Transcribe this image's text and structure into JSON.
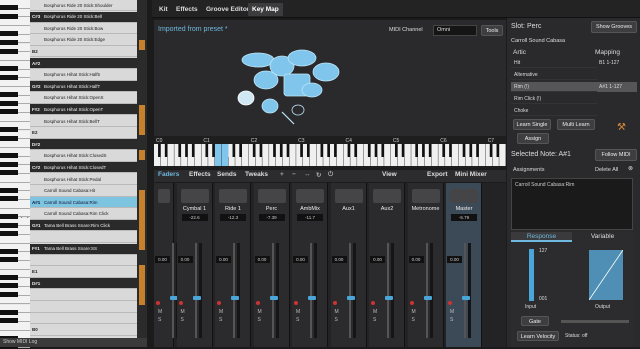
{
  "tabs": [
    "Kit",
    "Effects",
    "Groove Editor",
    "Key Map"
  ],
  "active_tab": "Key Map",
  "octave_labels": [
    "C3",
    "C2"
  ],
  "note_rows": [
    {
      "note": "",
      "label": "Bosphorus Ride 20 Stick:Shoulder",
      "style": "light"
    },
    {
      "note": "C#3",
      "label": "Bosphorus Ride 20 Stick:Bell",
      "style": "dark"
    },
    {
      "note": "",
      "label": "Bosphorus Ride 20 Stick:Bow",
      "style": "light"
    },
    {
      "note": "",
      "label": "Bosphorus Ride 20 Stick:Edge",
      "style": "light"
    },
    {
      "note": "B2",
      "label": "",
      "style": "light"
    },
    {
      "note": "A#2",
      "label": "",
      "style": "dark"
    },
    {
      "note": "",
      "label": "Bosphorus Hihat Stick:Half5",
      "style": "light"
    },
    {
      "note": "G#2",
      "label": "Bosphorus Hihat Stick:HalfT",
      "style": "dark"
    },
    {
      "note": "",
      "label": "Bosphorus Hihat Stick:OpenS",
      "style": "light"
    },
    {
      "note": "F#2",
      "label": "Bosphorus Hihat Stick:OpenT",
      "style": "dark"
    },
    {
      "note": "",
      "label": "Bosphorus Hihat Stick:BellT",
      "style": "light"
    },
    {
      "note": "E2",
      "label": "",
      "style": "light"
    },
    {
      "note": "D#2",
      "label": "",
      "style": "dark"
    },
    {
      "note": "",
      "label": "Bosphorus Hihat Stick:ClosedS",
      "style": "light"
    },
    {
      "note": "C#2",
      "label": "Bosphorus Hihat Stick:ClosedT",
      "style": "dark"
    },
    {
      "note": "",
      "label": "Bosphorus Hihat Stick:Pedal",
      "style": "light"
    },
    {
      "note": "",
      "label": "Carroll Sound Cabasa:Hit",
      "style": "light"
    },
    {
      "note": "A#1",
      "label": "Carroll Sound Cabasa:Rim",
      "style": "sel"
    },
    {
      "note": "",
      "label": "Carroll Sound Cabasa:Rim Click",
      "style": "light"
    },
    {
      "note": "G#1",
      "label": "Tama Bell Brass Snare:Rim Click",
      "style": "dark"
    },
    {
      "note": "",
      "label": "",
      "style": "light"
    },
    {
      "note": "F#1",
      "label": "Tama Bell Brass Snare:SS",
      "style": "dark"
    },
    {
      "note": "",
      "label": "",
      "style": "light"
    },
    {
      "note": "E1",
      "label": "",
      "style": "light"
    },
    {
      "note": "D#1",
      "label": "",
      "style": "dark"
    },
    {
      "note": "",
      "label": "",
      "style": "light"
    },
    {
      "note": "",
      "label": "",
      "style": "light"
    },
    {
      "note": "",
      "label": "",
      "style": "light"
    },
    {
      "note": "B0",
      "label": "",
      "style": "light"
    }
  ],
  "show_midi_log": "Show MIDI Log",
  "kit": {
    "imported": "Imported from preset *",
    "midi_channel_label": "MIDI Channel",
    "midi_channel_value": "Omni",
    "tools": "Tools"
  },
  "keyboard_octaves": [
    "C0",
    "C1",
    "C2",
    "C3",
    "C4",
    "C5",
    "C6",
    "C7",
    "C8"
  ],
  "mixer_tabs": [
    "Faders",
    "Effects",
    "Sends",
    "Tweaks"
  ],
  "mixer_right": [
    "View",
    "Export",
    "Mini Mixer"
  ],
  "strips": [
    {
      "name": "",
      "value": "",
      "level": "0.00"
    },
    {
      "name": "Cymbal 1",
      "value": "-22.6",
      "level": "0.00"
    },
    {
      "name": "Ride 1",
      "value": "-12.3",
      "level": "0.00"
    },
    {
      "name": "Perc",
      "value": "-7.39",
      "level": "0.00"
    },
    {
      "name": "AmbMix",
      "value": "-11.7",
      "level": "0.00"
    },
    {
      "name": "Aux1",
      "value": "",
      "level": "0.00"
    },
    {
      "name": "Aux2",
      "value": "",
      "level": "0.00"
    },
    {
      "name": "Metronome",
      "value": "",
      "level": "0.00"
    },
    {
      "name": "Master",
      "value": "-5.79",
      "level": "0.00"
    }
  ],
  "right": {
    "slot": "Slot: Perc",
    "show_grooves": "Show Grooves",
    "instrument": "Carroll Sound Cabasa",
    "artic_header": "Artic",
    "mapping_header": "Mapping",
    "artics": [
      "Hit",
      "Alternative",
      "Rim (!)",
      "Rim Click (!)",
      "Choke"
    ],
    "mappings": [
      "B1 1-127",
      "",
      "A#1 1-127",
      "",
      ""
    ],
    "learn_single": "Learn Single",
    "multi_learn": "Multi Learn",
    "assign": "Assign",
    "selected_note": "Selected Note: A#1",
    "follow_midi": "Follow MIDI",
    "assignments": "Assignments",
    "delete_all": "Delete All",
    "assignment_item": "Carroll Sound Cabasa:Rim",
    "response": "Response",
    "variable": "Variable",
    "v127": "127",
    "v001": "001",
    "input": "Input",
    "output": "Output",
    "gate": "Gate",
    "learn_velocity": "Learn Velocity",
    "status": "Status: off"
  },
  "colors": {
    "accent": "#6fb8de",
    "selected_row": "#7cc4e0",
    "orange": "#c7802c"
  }
}
